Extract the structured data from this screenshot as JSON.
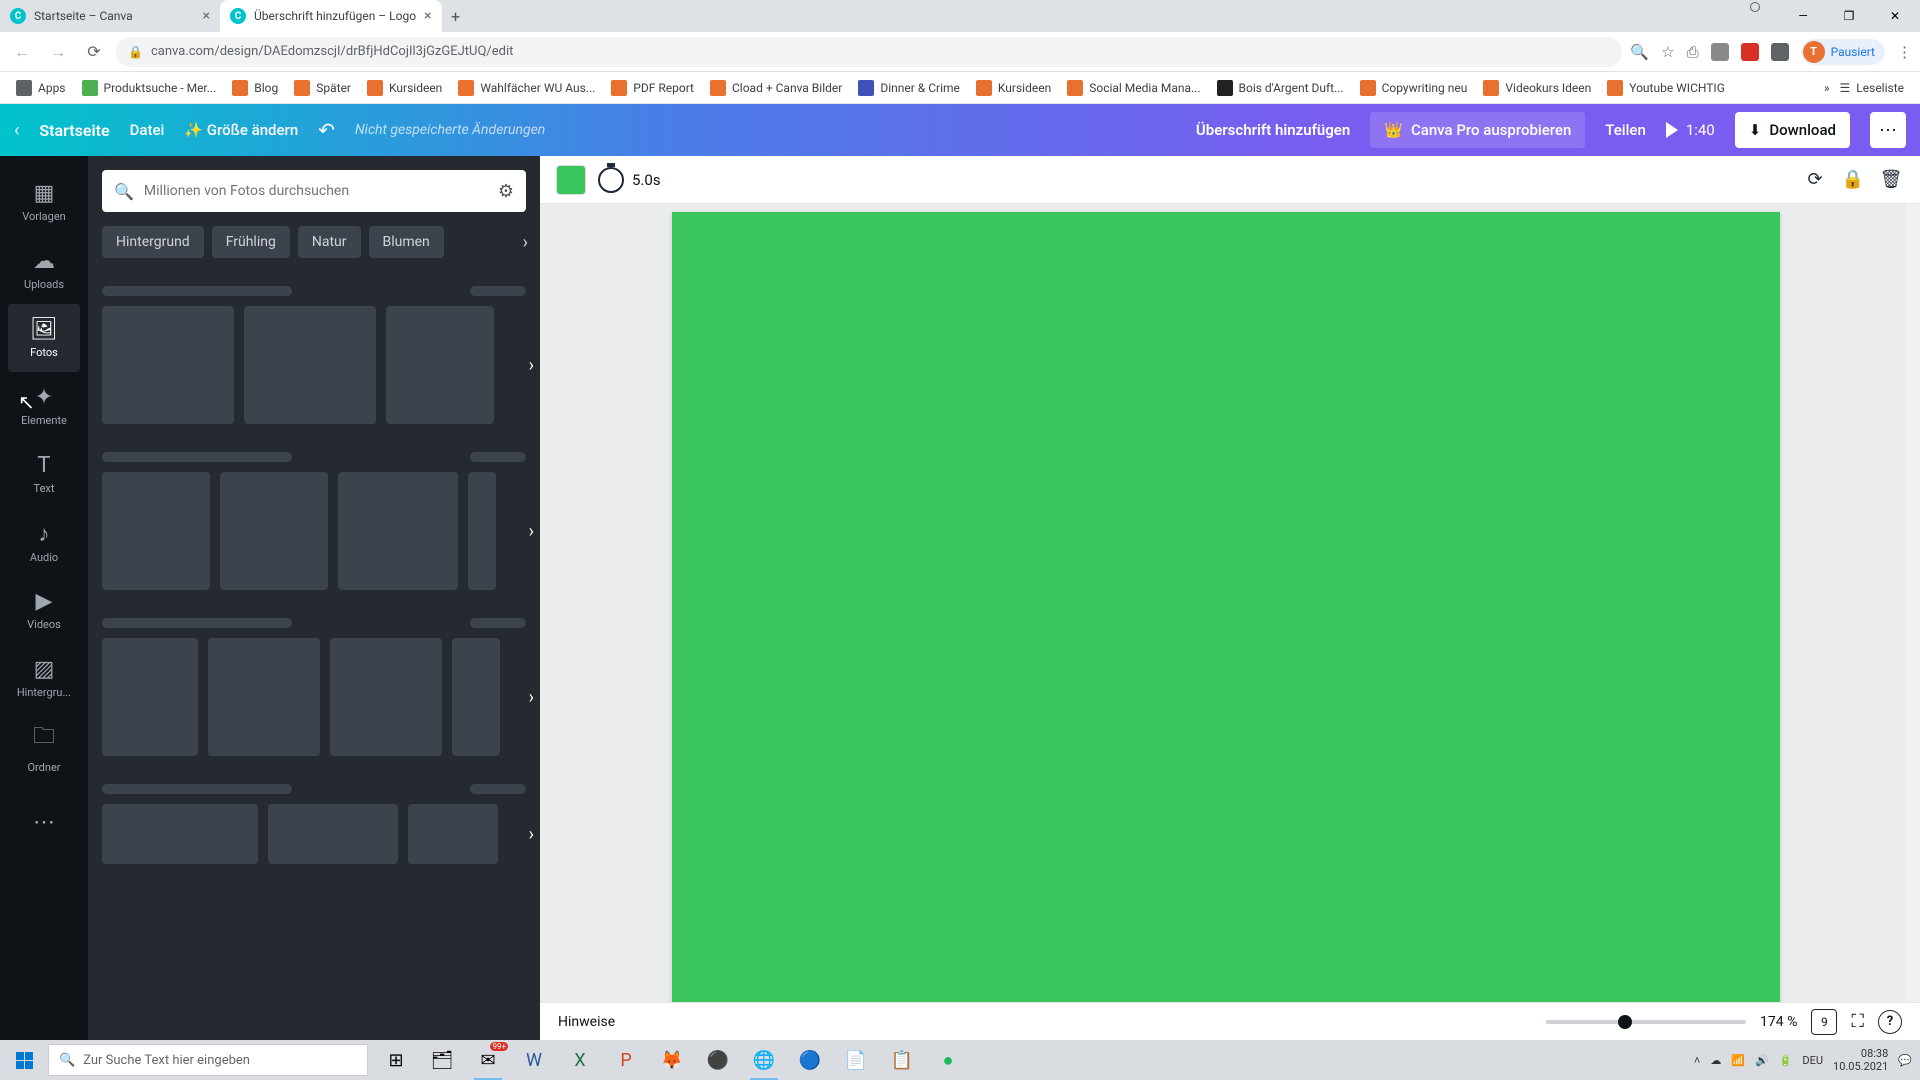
{
  "browser": {
    "tabs": [
      {
        "title": "Startseite – Canva",
        "active": false
      },
      {
        "title": "Überschrift hinzufügen – Logo",
        "active": true
      }
    ],
    "url": "canva.com/design/DAEdomzscjI/drBfjHdCojIl3jGzGEJtUQ/edit",
    "profile_initial": "T",
    "profile_status": "Pausiert"
  },
  "bookmarks": {
    "apps": "Apps",
    "items": [
      "Produktsuche - Mer...",
      "Blog",
      "Später",
      "Kursideen",
      "Wahlfächer WU Aus...",
      "PDF Report",
      "Cload + Canva Bilder",
      "Dinner & Crime",
      "Kursideen",
      "Social Media Mana...",
      "Bois d'Argent Duft...",
      "Copywriting neu",
      "Videokurs Ideen",
      "Youtube WICHTIG"
    ],
    "reading_list": "Leseliste"
  },
  "canva_top": {
    "home": "Startseite",
    "file": "Datei",
    "resize": "Größe ändern",
    "unsaved": "Nicht gespeicherte Änderungen",
    "doc_title": "Überschrift hinzufügen",
    "pro": "Canva Pro ausprobieren",
    "share": "Teilen",
    "play_time": "1:40",
    "download": "Download"
  },
  "rail": {
    "items": [
      "Vorlagen",
      "Uploads",
      "Fotos",
      "Elemente",
      "Text",
      "Audio",
      "Videos",
      "Hintergru...",
      "Ordner"
    ],
    "active_index": 2
  },
  "side": {
    "search_placeholder": "Millionen von Fotos durchsuchen",
    "chips": [
      "Hintergrund",
      "Frühling",
      "Natur",
      "Blumen"
    ]
  },
  "canvas": {
    "duration": "5.0s",
    "fill_color": "#3ac65c"
  },
  "footer": {
    "hints": "Hinweise",
    "zoom_label": "174 %",
    "pages": "9"
  },
  "taskbar": {
    "search_placeholder": "Zur Suche Text hier eingeben",
    "lang": "DEU",
    "time": "08:38",
    "date": "10.05.2021",
    "mail_badge": "99+"
  }
}
